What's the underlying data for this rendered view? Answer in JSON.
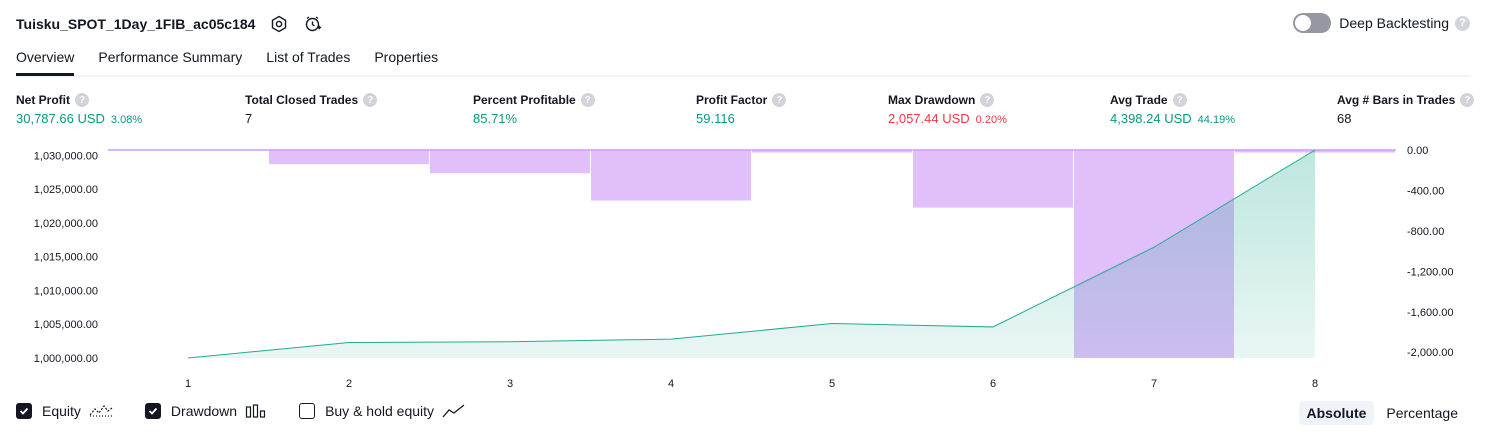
{
  "header": {
    "strategy_name": "Tuisku_SPOT_1Day_1FIB_ac05c184",
    "deep_backtesting_label": "Deep Backtesting",
    "help_glyph": "?"
  },
  "tabs": [
    {
      "label": "Overview",
      "active": true
    },
    {
      "label": "Performance Summary",
      "active": false
    },
    {
      "label": "List of Trades",
      "active": false
    },
    {
      "label": "Properties",
      "active": false
    }
  ],
  "metrics": [
    {
      "label": "Net Profit",
      "value": "30,787.66 USD",
      "pct": "3.08%",
      "color": "green"
    },
    {
      "label": "Total Closed Trades",
      "value": "7",
      "pct": "",
      "color": "dark"
    },
    {
      "label": "Percent Profitable",
      "value": "85.71%",
      "pct": "",
      "color": "green"
    },
    {
      "label": "Profit Factor",
      "value": "59.116",
      "pct": "",
      "color": "green"
    },
    {
      "label": "Max Drawdown",
      "value": "2,057.44 USD",
      "pct": "0.20%",
      "color": "red"
    },
    {
      "label": "Avg Trade",
      "value": "4,398.24 USD",
      "pct": "44.19%",
      "color": "green"
    },
    {
      "label": "Avg # Bars in Trades",
      "value": "68",
      "pct": "",
      "color": "dark"
    }
  ],
  "chart_data": {
    "type": "line",
    "x": [
      1,
      2,
      3,
      4,
      5,
      6,
      7,
      8
    ],
    "equity_series": {
      "name": "Equity",
      "values": [
        1000000,
        1002300,
        1002400,
        1002800,
        1005100,
        1004600,
        1016400,
        1030800
      ]
    },
    "drawdown_series": {
      "name": "Drawdown",
      "x": [
        1,
        2,
        3,
        4,
        5,
        6,
        7,
        8
      ],
      "values": [
        -5,
        -140,
        -230,
        -500,
        -25,
        -570,
        -2057,
        -25
      ]
    },
    "y_left_ticks": [
      "1,000,000.00",
      "1,005,000.00",
      "1,010,000.00",
      "1,015,000.00",
      "1,020,000.00",
      "1,025,000.00",
      "1,030,000.00"
    ],
    "y_left_values": [
      1000000,
      1005000,
      1010000,
      1015000,
      1020000,
      1025000,
      1030000
    ],
    "y_right_ticks": [
      "0.00",
      "-400.00",
      "-800.00",
      "-1,200.00",
      "-1,600.00",
      "-2,000.00"
    ],
    "y_right_values": [
      0,
      -400,
      -800,
      -1200,
      -1600,
      -2000
    ],
    "ylim_left": [
      1000000,
      1030800
    ],
    "ylim_right": [
      -2057.44,
      0
    ],
    "xlabel": "",
    "ylabel": "",
    "title": "",
    "colors": {
      "equity_line": "#22ab94",
      "equity_fill": "#22ab94",
      "drawdown_fill": "#cf9cf8"
    }
  },
  "footer": {
    "equity": {
      "label": "Equity",
      "checked": true
    },
    "drawdown": {
      "label": "Drawdown",
      "checked": true
    },
    "buyhold": {
      "label": "Buy & hold equity",
      "checked": false
    },
    "modes": [
      {
        "label": "Absolute",
        "active": true
      },
      {
        "label": "Percentage",
        "active": false
      }
    ]
  }
}
